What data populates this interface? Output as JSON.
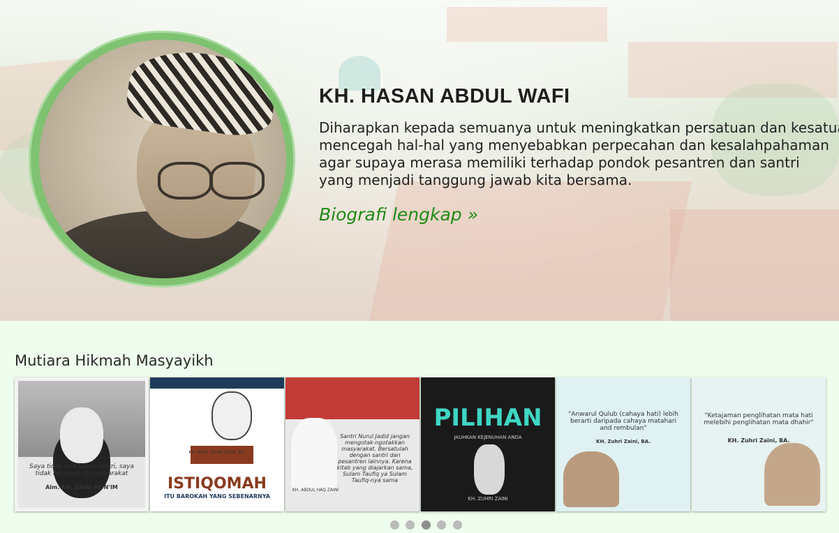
{
  "hero": {
    "name": "KH. HASAN ABDUL WAFI",
    "quote_lines": [
      "Diharapkan kepada semuanya untuk meningkatkan persatuan dan kesatuan,",
      "mencegah hal-hal yang menyebabkan perpecahan dan kesalahpahaman",
      "agar supaya merasa memiliki terhadap pondok pesantren dan santri",
      "yang menjadi tanggung jawab kita bersama."
    ],
    "link_label": "Biografi lengkap »",
    "ring_color": "#7fc271",
    "link_color": "#1f8a17"
  },
  "section": {
    "title": "Mutiara Hikmah Masyayikh"
  },
  "cards": [
    {
      "headline": "",
      "quote": "Saya tidak tela kalau santri, saya tidak berjuang di masyarakat",
      "author": "Alm. KH. ZAINI MUN'IM"
    },
    {
      "headline": "ISTIQOMAH",
      "subline": "ITU BAROKAH YANG SEBENARNYA",
      "author": "KH. MOH. ZUHRI ZAINI, BA."
    },
    {
      "quote": "Santri Nurul Jadid jangan mengotak-ngotakkan masyarakat. Bersatulah dengan santri dan pesantren lainnya. Karena kitab yang diajarkan sama, Sulam Taufiq ya Sulam Taufiq-nya sama",
      "author": "KH. ABDUL HAQ ZAINI"
    },
    {
      "headline": "PILIHAN",
      "subline": "JAUHKAN KEJENUHAN ANDA",
      "author": "KH. ZUHRI ZAINI"
    },
    {
      "quote": "\"Anwarul Qulub (cahaya hati) lebih berarti daripada cahaya matahari and rembulan\"",
      "author": "KH. Zuhri Zaini, BA."
    },
    {
      "quote": "\"Ketajaman penglihatan mata hati melebihi penglihatan mata dhahir\"",
      "author": "KH. Zuhri Zaini, BA."
    }
  ],
  "dots": {
    "count": 5,
    "active": 2
  }
}
